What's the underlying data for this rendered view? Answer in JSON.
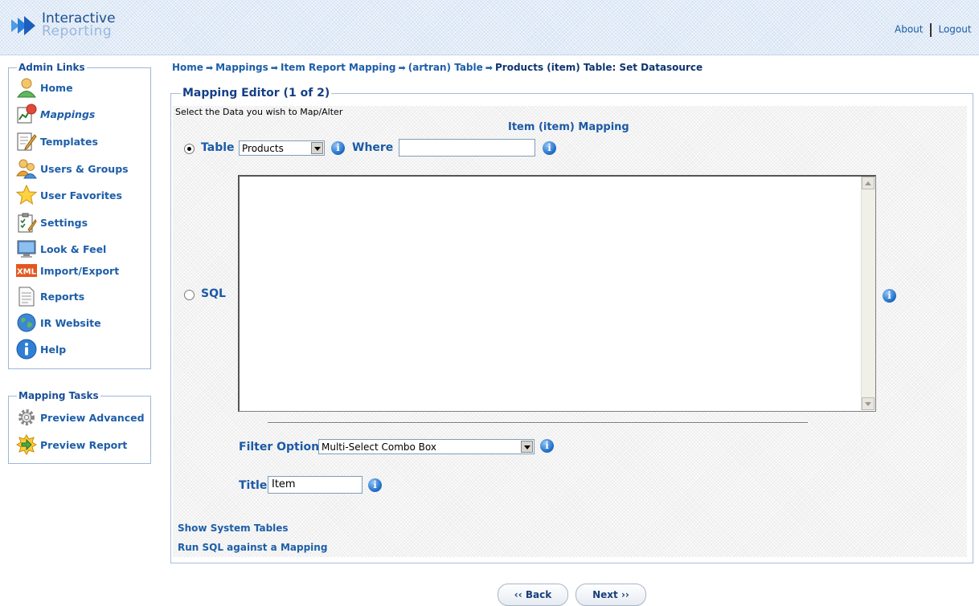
{
  "header": {
    "logo_line1": "Interactive",
    "logo_line2": "Reporting",
    "about": "About",
    "logout": "Logout"
  },
  "admin_links": {
    "title": "Admin Links",
    "items": [
      {
        "label": "Home",
        "icon": "home-user-icon"
      },
      {
        "label": "Mappings",
        "icon": "mappings-icon"
      },
      {
        "label": "Templates",
        "icon": "templates-icon"
      },
      {
        "label": "Users & Groups",
        "icon": "users-groups-icon"
      },
      {
        "label": "User Favorites",
        "icon": "star-icon"
      },
      {
        "label": "Settings",
        "icon": "settings-clipboard-icon"
      },
      {
        "label": "Look & Feel",
        "icon": "monitor-icon"
      },
      {
        "label": "Import/Export",
        "icon": "xml-icon"
      },
      {
        "label": "Reports",
        "icon": "report-document-icon"
      },
      {
        "label": "IR Website",
        "icon": "globe-icon"
      },
      {
        "label": "Help",
        "icon": "help-info-icon"
      }
    ]
  },
  "mapping_tasks": {
    "title": "Mapping Tasks",
    "items": [
      {
        "label": "Preview Advanced",
        "icon": "gear-icon"
      },
      {
        "label": "Preview Report",
        "icon": "arrow-burst-icon"
      }
    ]
  },
  "breadcrumb": [
    "Home",
    "Mappings",
    "Item Report Mapping",
    "(artran) Table",
    "Products (item) Table: Set Datasource"
  ],
  "editor": {
    "title": "Mapping Editor (1 of 2)",
    "instruction": "Select the Data you wish to Map/Alter",
    "heading": "Item (item) Mapping",
    "table_label": "Table",
    "table_value": "Products",
    "where_label": "Where",
    "where_value": "",
    "sql_label": "SQL",
    "sql_value": "",
    "filter_label": "Filter Option",
    "filter_value": "Multi-Select Combo Box",
    "title_label": "Title",
    "title_value": "Item",
    "show_system_tables": "Show System Tables",
    "run_sql": "Run SQL against a Mapping"
  },
  "buttons": {
    "back": "‹‹ Back",
    "next": "Next ››"
  },
  "colors": {
    "link_blue": "#1d5ea8",
    "heading_blue": "#153f86"
  }
}
